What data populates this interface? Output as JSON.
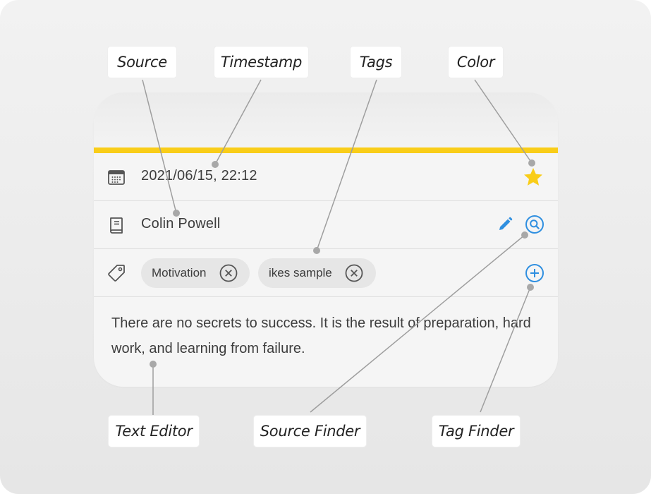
{
  "note": {
    "date": "2021/06/15, 22:12",
    "source": "Colin Powell",
    "tags": [
      {
        "label": "Motivation"
      },
      {
        "label": "ikes sample"
      }
    ],
    "text": "There are no secrets to success. It is the result of preparation, hard work, and learning from failure.",
    "accent_color": "#f9cd19",
    "star_color": "#f9cd19",
    "action_color": "#2f8fe0"
  },
  "callouts": {
    "source": "Source",
    "timestamp": "Timestamp",
    "tags": "Tags",
    "color": "Color",
    "text_editor": "Text Editor",
    "source_finder": "Source Finder",
    "tag_finder": "Tag Finder"
  },
  "icons": {
    "date": "calendar-icon",
    "source": "book-icon",
    "tags": "tag-icon",
    "color": "star-icon",
    "edit": "pencil-icon",
    "source_finder": "search-icon",
    "tag_finder": "add-icon",
    "remove_tag": "close-icon"
  }
}
